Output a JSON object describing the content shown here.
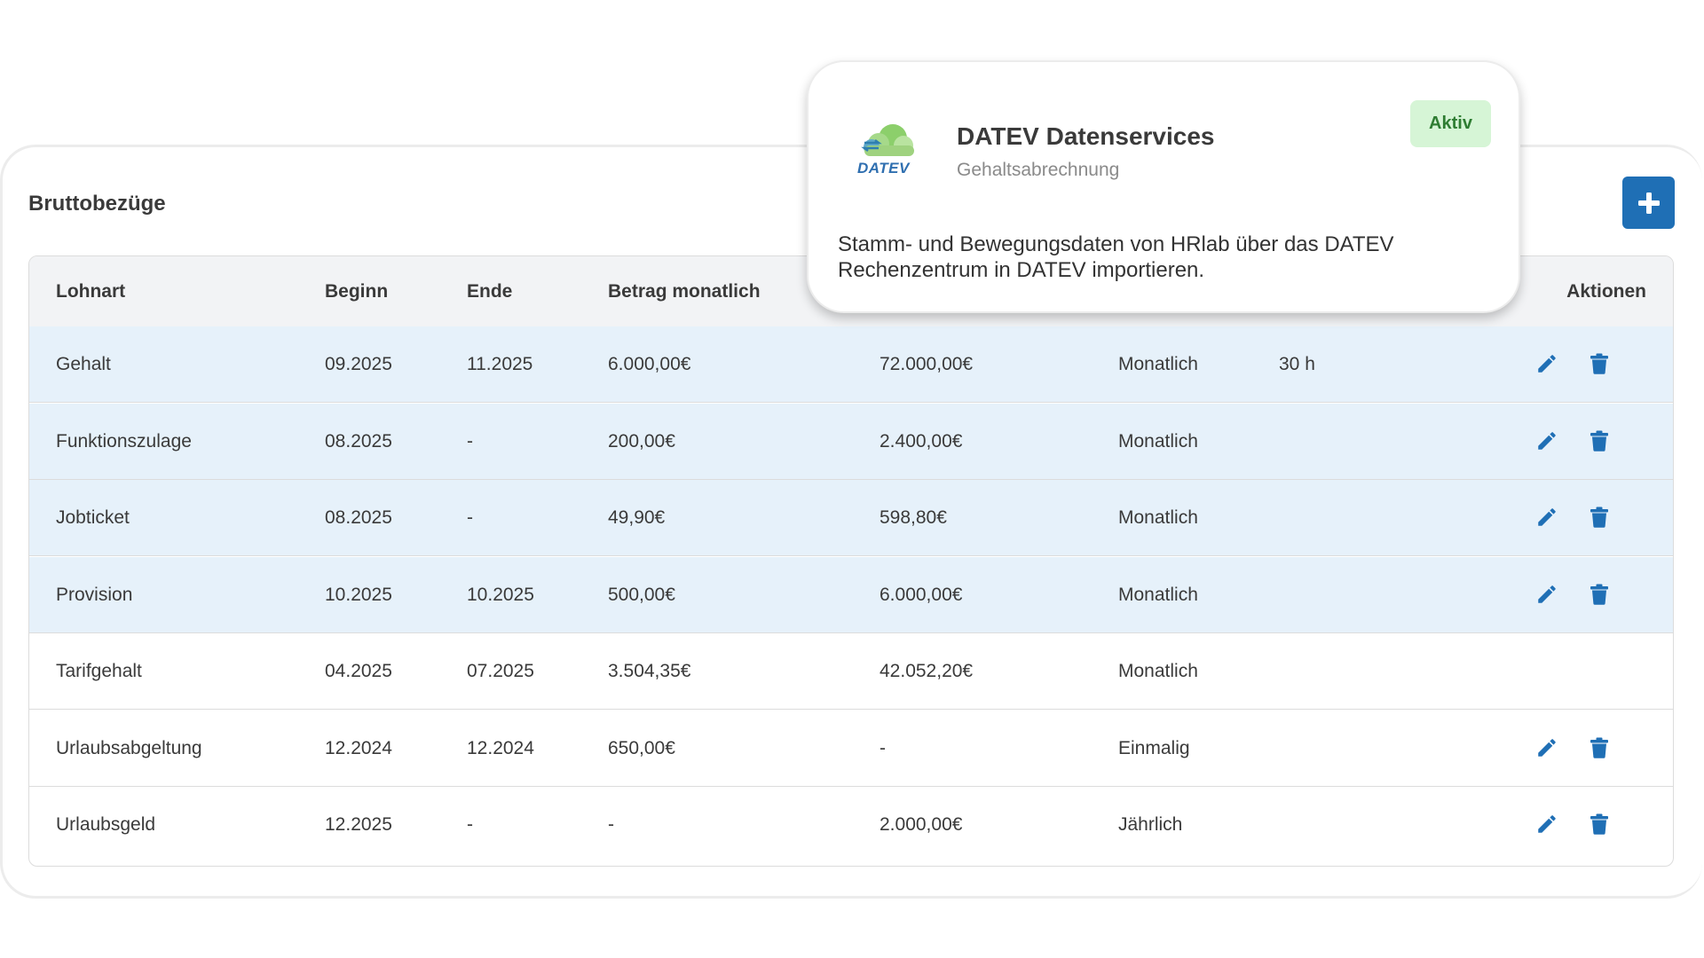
{
  "section": {
    "title": "Bruttobezüge"
  },
  "table": {
    "headers": [
      "Lohnart",
      "Beginn",
      "Ende",
      "Betrag monatlich",
      "",
      "",
      "",
      "Aktionen"
    ],
    "rows": [
      {
        "lohnart": "Gehalt",
        "beginn": "09.2025",
        "ende": "11.2025",
        "betrag": "6.000,00€",
        "jahr": "72.000,00€",
        "intervall": "Monatlich",
        "stunden": "30 h",
        "actions": true,
        "highlight": true
      },
      {
        "lohnart": "Funktionszulage",
        "beginn": "08.2025",
        "ende": "-",
        "betrag": "200,00€",
        "jahr": "2.400,00€",
        "intervall": "Monatlich",
        "stunden": "",
        "actions": true,
        "highlight": true
      },
      {
        "lohnart": "Jobticket",
        "beginn": "08.2025",
        "ende": "-",
        "betrag": "49,90€",
        "jahr": "598,80€",
        "intervall": "Monatlich",
        "stunden": "",
        "actions": true,
        "highlight": true
      },
      {
        "lohnart": "Provision",
        "beginn": "10.2025",
        "ende": "10.2025",
        "betrag": "500,00€",
        "jahr": "6.000,00€",
        "intervall": "Monatlich",
        "stunden": "",
        "actions": true,
        "highlight": true
      },
      {
        "lohnart": "Tarifgehalt",
        "beginn": "04.2025",
        "ende": "07.2025",
        "betrag": "3.504,35€",
        "jahr": "42.052,20€",
        "intervall": "Monatlich",
        "stunden": "",
        "actions": false,
        "highlight": false
      },
      {
        "lohnart": "Urlaubsabgeltung",
        "beginn": "12.2024",
        "ende": "12.2024",
        "betrag": "650,00€",
        "jahr": "-",
        "intervall": "Einmalig",
        "stunden": "",
        "actions": true,
        "highlight": false
      },
      {
        "lohnart": "Urlaubsgeld",
        "beginn": "12.2025",
        "ende": "-",
        "betrag": "-",
        "jahr": "2.000,00€",
        "intervall": "Jährlich",
        "stunden": "",
        "actions": true,
        "highlight": false
      }
    ]
  },
  "popup": {
    "title": "DATEV Datenservices",
    "subtitle": "Gehaltsabrechnung",
    "badge": "Aktiv",
    "description": "Stamm- und Bewegungsdaten von HRlab über das DATEV Rechenzentrum in DATEV importieren.",
    "logo_text": "DATEV"
  },
  "icons": {
    "add": "plus-icon",
    "edit": "pencil-icon",
    "delete": "trash-icon"
  },
  "colors": {
    "accent": "#1f6fb5",
    "highlight_row": "#e6f1fa",
    "badge_bg": "#d6f5d6",
    "badge_text": "#2e7d32"
  }
}
